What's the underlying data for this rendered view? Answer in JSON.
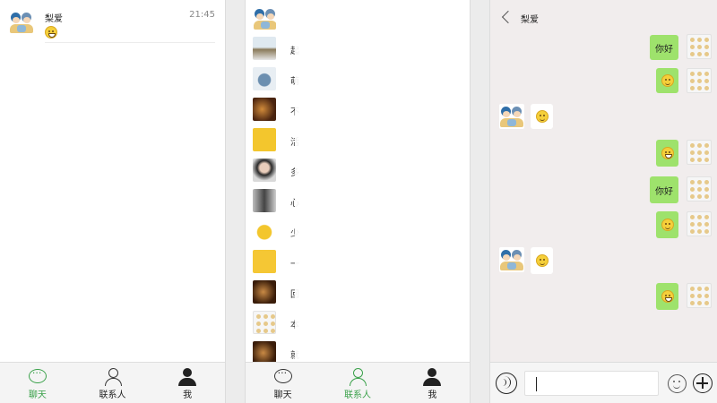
{
  "colors": {
    "accent": "#3aa14a",
    "bubble_out": "#9ee26c",
    "conv_bg": "#f1eded"
  },
  "chat_list": {
    "items": [
      {
        "name": "梨爱",
        "time": "21:45",
        "preview_icon": "grin-emoji-icon"
      }
    ]
  },
  "contacts": {
    "items": [
      {
        "label": "",
        "avatar": "cartoon"
      },
      {
        "label": "起",
        "avatar": "photo-landscape"
      },
      {
        "label": "萌",
        "avatar": "photo-animal"
      },
      {
        "label": "不",
        "avatar": "photo-dark"
      },
      {
        "label": "活",
        "avatar": "sticker-yellow"
      },
      {
        "label": "多",
        "avatar": "photo-person"
      },
      {
        "label": "心",
        "avatar": "photo-bw"
      },
      {
        "label": "少",
        "avatar": "sticker-face"
      },
      {
        "label": "一",
        "avatar": "sticker-yellow"
      },
      {
        "label": "回",
        "avatar": "photo-dark"
      },
      {
        "label": "本",
        "avatar": "sticker-grid"
      },
      {
        "label": "就",
        "avatar": "photo-dark"
      }
    ]
  },
  "tabs": [
    {
      "label": "聊天",
      "icon": "chat-icon"
    },
    {
      "label": "联系人",
      "icon": "contacts-icon"
    },
    {
      "label": "我",
      "icon": "me-icon"
    }
  ],
  "conversation": {
    "title": "梨爱",
    "messages": [
      {
        "from": "me",
        "text": "你好"
      },
      {
        "from": "me",
        "emoji": "smile-emoji-icon"
      },
      {
        "from": "them",
        "emoji": "smile-emoji-icon"
      },
      {
        "from": "me",
        "emoji": "grin-emoji-icon"
      },
      {
        "from": "me",
        "text": "你好"
      },
      {
        "from": "me",
        "emoji": "smile-emoji-icon"
      },
      {
        "from": "them",
        "emoji": "smile-emoji-icon"
      },
      {
        "from": "me",
        "emoji": "grin-emoji-icon"
      }
    ],
    "input_value": ""
  }
}
